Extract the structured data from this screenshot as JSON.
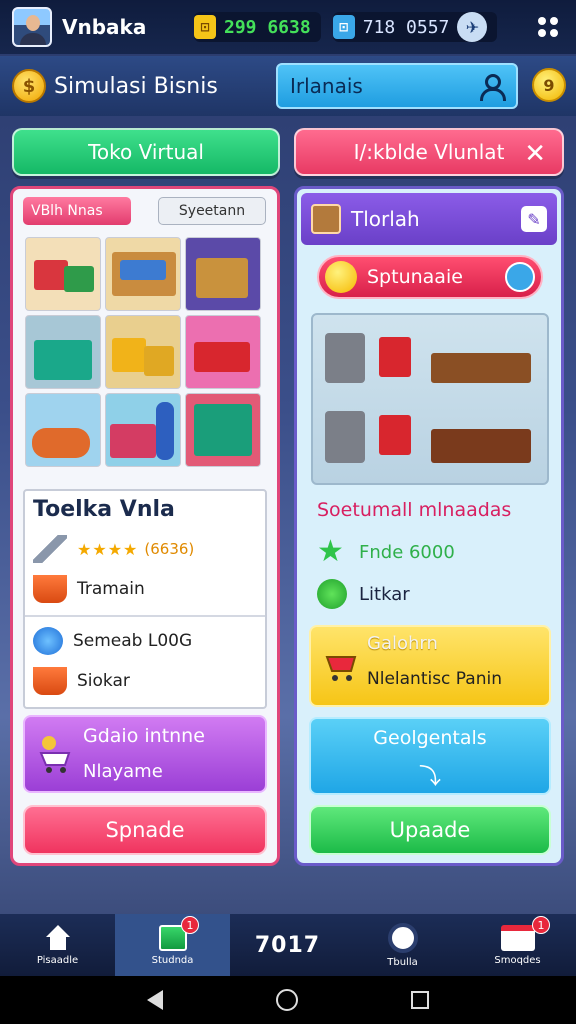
{
  "header": {
    "username": "Vnbaka",
    "currency_gold_label": "⊡",
    "currency_gold_value": "299 6638",
    "currency_blue_label": "⊡",
    "currency_blue_value": "718 0557"
  },
  "title_bar": {
    "title": "Simulasi Bisnis",
    "search_placeholder": "Irlanais"
  },
  "tabs": {
    "left": "Toko Virtual",
    "right": "I/:kblde Vlunlat"
  },
  "left_panel": {
    "chip_pink": "VBlh Nnas",
    "chip_grey": "Syeetann",
    "info": {
      "title": "Toelka Vnla",
      "rating_stars": "★★★★",
      "rating_count": "(6636)",
      "row1": "Tramain",
      "row2": "Semeab L00G",
      "row3": "Siokar"
    },
    "purple_card": {
      "title": "Gdaio intnne",
      "subtitle": "Nlayame"
    },
    "button": "Spnade"
  },
  "right_panel": {
    "header": "Tlorlah",
    "pill": "Sptunaaie",
    "subtitle": "Soetumall mlnaadas",
    "stat1": "Fnde 6000",
    "stat2": "Litkar",
    "yellow_card": {
      "title": "Galohrn",
      "subtitle": "Nlelantisc Panin"
    },
    "blue_card": {
      "title": "Geolgentals",
      "arrow": "⤵"
    },
    "button": "Upaade"
  },
  "bottom_nav": {
    "items": [
      {
        "label": "Pisaadle"
      },
      {
        "label": "Studnda",
        "badge": "1"
      },
      {
        "big": "7017"
      },
      {
        "label": "Tbulla"
      },
      {
        "label": "Smoqdes",
        "badge": "1"
      }
    ]
  }
}
